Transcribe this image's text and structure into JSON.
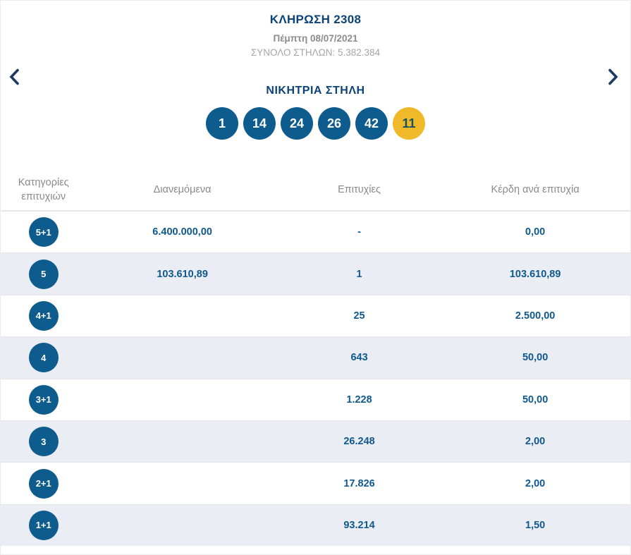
{
  "header": {
    "draw_title": "ΚΛΗΡΩΣΗ 2308",
    "draw_date": "Πέμπτη 08/07/2021",
    "total_columns": "ΣΥΝΟΛΟ ΣΤΗΛΩΝ: 5.382.384"
  },
  "navigation": {
    "prev_icon": "chevron-left",
    "next_icon": "chevron-right"
  },
  "winning": {
    "title": "ΝΙΚΗΤΡΙΑ ΣΤΗΛΗ",
    "numbers": [
      "1",
      "14",
      "24",
      "26",
      "42"
    ],
    "joker": "11"
  },
  "colors": {
    "ball_blue": "#0e5c8d",
    "joker_yellow": "#f0b929",
    "joker_text": "#14525c",
    "value_blue": "#10598c",
    "title_navy": "#0b4377",
    "muted_gray": "#8c8c8c",
    "alt_row_bg": "#eaedf3"
  },
  "table": {
    "headers": {
      "category": "Κατηγορίες επιτυχιών",
      "distributed": "Διανεμόμενα",
      "winners": "Επιτυχίες",
      "prize": "Κέρδη ανά επιτυχία"
    },
    "rows": [
      {
        "category": "5+1",
        "distributed": "6.400.000,00",
        "winners": "-",
        "prize": "0,00"
      },
      {
        "category": "5",
        "distributed": "103.610,89",
        "winners": "1",
        "prize": "103.610,89"
      },
      {
        "category": "4+1",
        "distributed": "",
        "winners": "25",
        "prize": "2.500,00"
      },
      {
        "category": "4",
        "distributed": "",
        "winners": "643",
        "prize": "50,00"
      },
      {
        "category": "3+1",
        "distributed": "",
        "winners": "1.228",
        "prize": "50,00"
      },
      {
        "category": "3",
        "distributed": "",
        "winners": "26.248",
        "prize": "2,00"
      },
      {
        "category": "2+1",
        "distributed": "",
        "winners": "17.826",
        "prize": "2,00"
      },
      {
        "category": "1+1",
        "distributed": "",
        "winners": "93.214",
        "prize": "1,50"
      }
    ]
  }
}
